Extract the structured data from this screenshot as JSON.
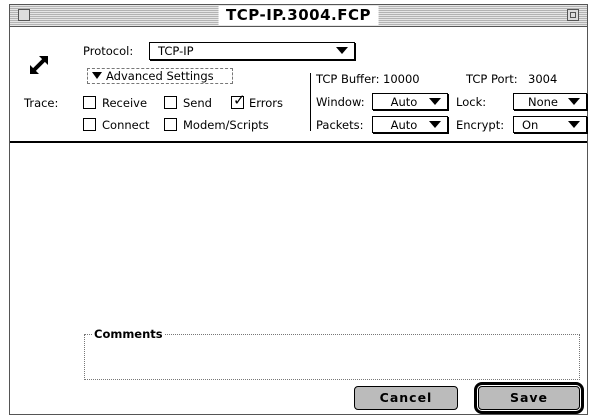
{
  "window": {
    "title": "TCP-IP.3004.FCP"
  },
  "protocol": {
    "label": "Protocol:",
    "value": "TCP-IP"
  },
  "advanced": {
    "label": "Advanced Settings"
  },
  "trace": {
    "label": "Trace:",
    "receive": {
      "label": "Receive",
      "checked": false
    },
    "send": {
      "label": "Send",
      "checked": false
    },
    "errors": {
      "label": "Errors",
      "checked": true
    },
    "connect": {
      "label": "Connect",
      "checked": false
    },
    "modem": {
      "label": "Modem/Scripts",
      "checked": false
    }
  },
  "tcp": {
    "buffer_label": "TCP Buffer:",
    "buffer_value": "10000",
    "port_label": "TCP Port:",
    "port_value": "3004"
  },
  "settings": {
    "window_label": "Window:",
    "window_value": "Auto",
    "lock_label": "Lock:",
    "lock_value": "None",
    "packets_label": "Packets:",
    "packets_value": "Auto",
    "encrypt_label": "Encrypt:",
    "encrypt_value": "On"
  },
  "comments": {
    "label": "Comments",
    "value": ""
  },
  "buttons": {
    "cancel": "Cancel",
    "save": "Save"
  },
  "icons": {
    "connection": "diagonal-double-arrow-icon",
    "close": "close-box-icon",
    "zoom": "zoom-box-icon"
  }
}
